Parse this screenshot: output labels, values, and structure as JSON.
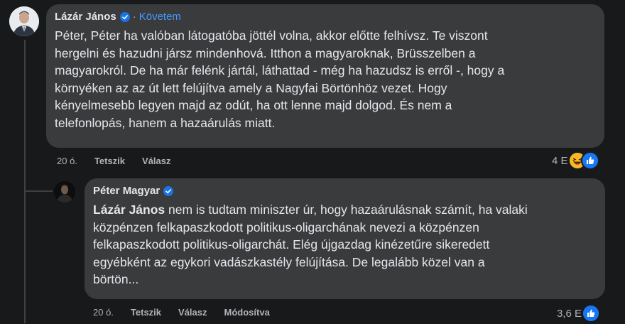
{
  "comment1": {
    "author": "Lázár János",
    "separator": "·",
    "follow_label": "Követem",
    "text": "Péter, Péter ha valóban látogatóba jöttél volna, akkor előtte felhívsz. Te viszont\nhergelni és hazudni jársz mindenhová. Itthon a magyaroknak, Brüsszelben a\nmagyarokról. De ha már felénk jártál, láthattad - még ha hazudsz is erről -, hogy a\nkörnyéken az az út lett felújítva amely a Nagyfai Börtönhöz vezet. Hogy\nkényelmesebb legyen majd az odút, ha ott lenne majd dolgod. És nem a\ntelefonlopás, hanem a hazaárulás miatt.",
    "time": "20 ó.",
    "like_label": "Tetszik",
    "reply_label": "Válasz",
    "reaction_count": "4 E",
    "reactions": [
      "haha-icon",
      "like-icon"
    ]
  },
  "comment2": {
    "author": "Péter Magyar",
    "mention": "Lázár János",
    "text": " nem is tudtam miniszter úr, hogy hazaárulásnak számít, ha valaki\nközpénzen felkapaszkodott politikus-oligarchának nevezi a közpénzen\nfelkapaszkodott politikus-oligarchát. Elég újgazdag kinézetűre sikeredett\negyébként az egykori vadászkastély felújítása. De legalább közel van a\nbörtön...",
    "time": "20 ó.",
    "like_label": "Tetszik",
    "reply_label": "Válasz",
    "edited_label": "Módosítva",
    "reaction_count": "3,6 E",
    "reactions": [
      "like-icon"
    ]
  },
  "colors": {
    "background": "#18191a",
    "bubble": "#3a3b3c",
    "text": "#e4e6eb",
    "muted": "#b0b3b8",
    "link": "#4599ff",
    "verified": "#1b74e4",
    "like": "#1877f2",
    "haha": "#f7b928"
  }
}
